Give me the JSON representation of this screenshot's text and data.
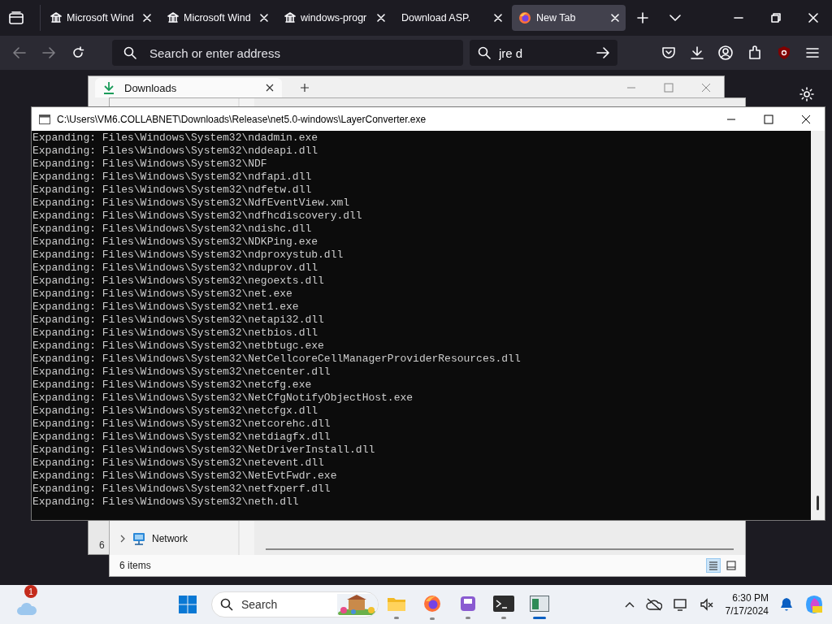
{
  "browser": {
    "tabs": [
      {
        "label": "Microsoft Wind",
        "kind": "building",
        "selected": false
      },
      {
        "label": "Microsoft Wind",
        "kind": "building",
        "selected": false
      },
      {
        "label": "windows-progr",
        "kind": "building",
        "selected": false
      },
      {
        "label": "Download ASP.",
        "kind": "blank",
        "selected": false
      },
      {
        "label": "New Tab",
        "kind": "firefox",
        "selected": true
      }
    ],
    "toolbar": {
      "back_disabled": true,
      "forward_disabled": true,
      "address_placeholder": "Search or enter address",
      "search_value": "jre d"
    }
  },
  "explorer_back": {
    "tab_title": "Downloads",
    "status": "6"
  },
  "explorer_front": {
    "tree_items": [
      {
        "label": "Network",
        "expanded": false
      }
    ],
    "status": "6 items",
    "views": [
      {
        "kind": "details",
        "selected": true
      },
      {
        "kind": "tiles",
        "selected": false
      }
    ]
  },
  "console": {
    "title": "C:\\Users\\VM6.COLLABNET\\Downloads\\Release\\net5.0-windows\\LayerConverter.exe",
    "lines": [
      "Expanding: Files\\Windows\\System32\\ndadmin.exe",
      "Expanding: Files\\Windows\\System32\\nddeapi.dll",
      "Expanding: Files\\Windows\\System32\\NDF",
      "Expanding: Files\\Windows\\System32\\ndfapi.dll",
      "Expanding: Files\\Windows\\System32\\ndfetw.dll",
      "Expanding: Files\\Windows\\System32\\NdfEventView.xml",
      "Expanding: Files\\Windows\\System32\\ndfhcdiscovery.dll",
      "Expanding: Files\\Windows\\System32\\ndishc.dll",
      "Expanding: Files\\Windows\\System32\\NDKPing.exe",
      "Expanding: Files\\Windows\\System32\\ndproxystub.dll",
      "Expanding: Files\\Windows\\System32\\nduprov.dll",
      "Expanding: Files\\Windows\\System32\\negoexts.dll",
      "Expanding: Files\\Windows\\System32\\net.exe",
      "Expanding: Files\\Windows\\System32\\net1.exe",
      "Expanding: Files\\Windows\\System32\\netapi32.dll",
      "Expanding: Files\\Windows\\System32\\netbios.dll",
      "Expanding: Files\\Windows\\System32\\netbtugc.exe",
      "Expanding: Files\\Windows\\System32\\NetCellcoreCellManagerProviderResources.dll",
      "Expanding: Files\\Windows\\System32\\netcenter.dll",
      "Expanding: Files\\Windows\\System32\\netcfg.exe",
      "Expanding: Files\\Windows\\System32\\NetCfgNotifyObjectHost.exe",
      "Expanding: Files\\Windows\\System32\\netcfgx.dll",
      "Expanding: Files\\Windows\\System32\\netcorehc.dll",
      "Expanding: Files\\Windows\\System32\\netdiagfx.dll",
      "Expanding: Files\\Windows\\System32\\NetDriverInstall.dll",
      "Expanding: Files\\Windows\\System32\\netevent.dll",
      "Expanding: Files\\Windows\\System32\\NetEvtFwdr.exe",
      "Expanding: Files\\Windows\\System32\\netfxperf.dll",
      "Expanding: Files\\Windows\\System32\\neth.dll"
    ]
  },
  "taskbar": {
    "weather_badge": "1",
    "search_placeholder": "Search",
    "apps": [
      {
        "kind": "explorer",
        "active": false
      },
      {
        "kind": "firefox",
        "active": false
      },
      {
        "kind": "app",
        "active": false
      },
      {
        "kind": "terminal",
        "active": false
      },
      {
        "kind": "console",
        "active": true
      }
    ],
    "time": "6:30 PM",
    "date": "7/17/2024"
  }
}
